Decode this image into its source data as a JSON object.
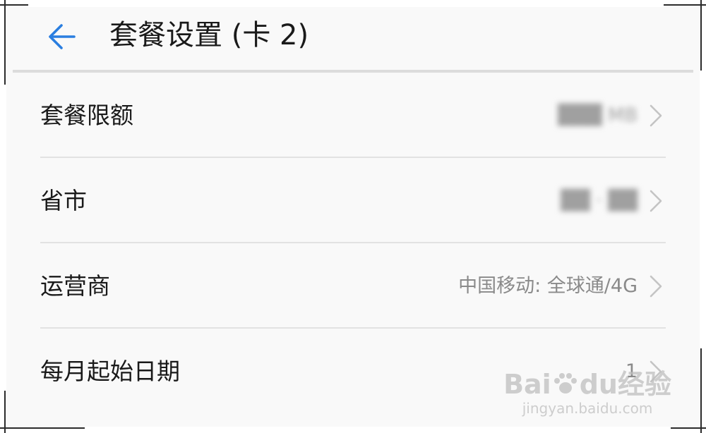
{
  "header": {
    "title": "套餐设置 (卡 2)",
    "back_icon": "arrow-left-icon",
    "accent_color": "#2a7ee0"
  },
  "settings": [
    {
      "label": "套餐限额",
      "value": "███ MB",
      "value_obscured": true
    },
    {
      "label": "省市",
      "value": "██ · ██",
      "value_obscured": true
    },
    {
      "label": "运营商",
      "value": "中国移动: 全球通/4G",
      "value_obscured": false
    },
    {
      "label": "每月起始日期",
      "value": "1",
      "value_obscured": false
    }
  ],
  "chevron_icon": "chevron-right-icon",
  "watermark": {
    "main_left": "Bai",
    "main_right": "du",
    "main_suffix": "经验",
    "sub": "jingyan.baidu.com"
  }
}
